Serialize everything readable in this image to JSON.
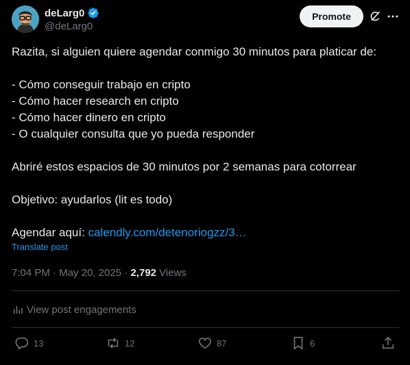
{
  "author": {
    "display_name": "deLarg0",
    "handle": "@deLarg0",
    "verified": true,
    "avatar_icon": "avatar-illustration-icon"
  },
  "header": {
    "promote_label": "Promote",
    "grok_icon": "grok-icon",
    "more_icon": "more-icon"
  },
  "post": {
    "lines": [
      "Razita, si alguien quiere agendar conmigo 30 minutos para platicar de:",
      "",
      "- Cómo conseguir trabajo en cripto",
      "- Cómo hacer research en cripto",
      "- Cómo hacer dinero en cripto",
      "- O cualquier consulta que yo pueda responder",
      "",
      "Abriré estos espacios de 30 minutos por 2 semanas para cotorrear",
      "",
      "Objetivo: ayudarlos (lit es todo)",
      ""
    ],
    "schedule_prefix": "Agendar aquí: ",
    "schedule_link": "calendly.com/detenoriogzz/3…",
    "translate_label": "Translate post",
    "time": "7:04 PM",
    "separator1": " · ",
    "date": "May 20, 2025",
    "separator2": " · ",
    "views_count": "2,792",
    "views_label": " Views"
  },
  "engagements_label": "View post engagements",
  "actions": {
    "replies": "13",
    "reposts": "12",
    "likes": "87",
    "bookmarks": "6"
  },
  "colors": {
    "background": "#000000",
    "text": "#e7e9ea",
    "muted": "#71767b",
    "link": "#1d9bf0",
    "divider": "#2f3336",
    "verified": "#1d9bf0"
  }
}
